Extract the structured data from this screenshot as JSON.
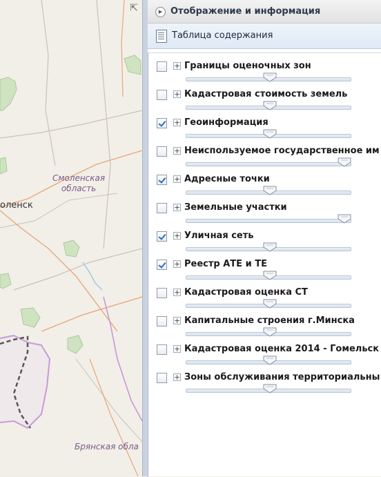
{
  "panel": {
    "header_title": "Отображение и информация",
    "toc_label": "Таблица содержания"
  },
  "map": {
    "region_label": "Смоленская\nобласть",
    "city_label": "оленск",
    "region2_label": "Брянская обла"
  },
  "layers": [
    {
      "name": "Границы оценочных зон",
      "checked": false,
      "opacity": 0.5
    },
    {
      "name": "Кадастровая стоимость земель",
      "checked": false,
      "opacity": 0.5
    },
    {
      "name": "Геоинформация",
      "checked": true,
      "opacity": 0.5
    },
    {
      "name": "Неиспользуемое государственное им",
      "checked": false,
      "opacity": 1.0
    },
    {
      "name": "Адресные точки",
      "checked": true,
      "opacity": 0.5
    },
    {
      "name": "Земельные участки",
      "checked": false,
      "opacity": 1.0
    },
    {
      "name": "Уличная сеть",
      "checked": true,
      "opacity": 0.5
    },
    {
      "name": "Реестр АТЕ и ТЕ",
      "checked": true,
      "opacity": 0.5
    },
    {
      "name": "Кадастровая оценка СТ",
      "checked": false,
      "opacity": 0.5
    },
    {
      "name": "Капитальные строения г.Минска",
      "checked": false,
      "opacity": 0.5
    },
    {
      "name": "Кадастровая оценка 2014 - Гомельск",
      "checked": false,
      "opacity": 0.5
    },
    {
      "name": "Зоны обслуживания территориальны:",
      "checked": false,
      "opacity": 0.5
    }
  ]
}
